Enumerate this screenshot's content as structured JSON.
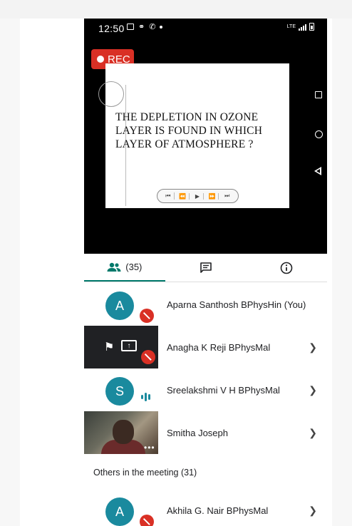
{
  "status_bar": {
    "time": "12:50",
    "network": "LTE"
  },
  "recording": {
    "label": "REC"
  },
  "slide": {
    "text_lines": [
      "THE  DEPLETION  IN OZONE",
      "LAYER  IS  FOUND  IN  WHICH",
      "LAYER  OF  ATMOSPHERE ?"
    ]
  },
  "tabs": {
    "people_count": "(35)"
  },
  "participants": [
    {
      "initial": "A",
      "name": "Aparna Santhosh BPhysHin (You)"
    },
    {
      "initial": "",
      "name": "Anagha K Reji BPhysMal"
    },
    {
      "initial": "S",
      "name": "Sreelakshmi V H BPhysMal"
    },
    {
      "initial": "",
      "name": "Smitha Joseph"
    }
  ],
  "others": {
    "label": "Others in the meeting (31)",
    "participant": {
      "initial": "A",
      "name": "Akhila G. Nair BPhysMal"
    }
  },
  "colors": {
    "accent": "#1a8a9e",
    "rec": "#d93025",
    "tab_underline": "#00796b"
  }
}
